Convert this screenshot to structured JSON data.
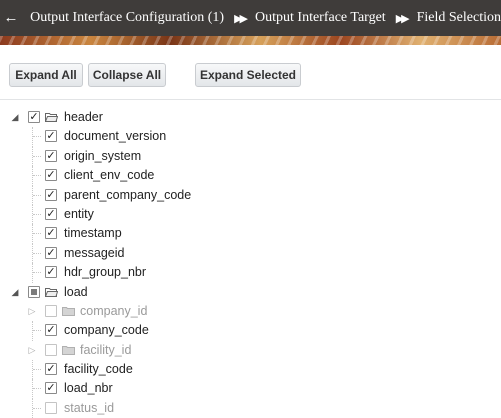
{
  "breadcrumb": {
    "back_icon": "back-arrow-icon",
    "items": [
      "Output Interface Configuration (1)",
      "Output Interface Target",
      "Field Selection"
    ],
    "separator": "▶▶"
  },
  "toolbar": {
    "expand_all": "Expand All",
    "collapse_all": "Collapse All",
    "expand_selected": "Expand Selected"
  },
  "tree": {
    "header": {
      "label": "header",
      "state": "checked",
      "children": [
        "document_version",
        "origin_system",
        "client_env_code",
        "parent_company_code",
        "entity",
        "timestamp",
        "messageid",
        "hdr_group_nbr"
      ]
    },
    "load": {
      "label": "load",
      "state": "partial",
      "children": [
        {
          "label": "company_id",
          "state": "unchecked",
          "folder": true
        },
        {
          "label": "company_code",
          "state": "checked"
        },
        {
          "label": "facility_id",
          "state": "unchecked",
          "folder": true
        },
        {
          "label": "facility_code",
          "state": "checked"
        },
        {
          "label": "load_nbr",
          "state": "checked"
        },
        {
          "label": "status_id",
          "state": "unchecked"
        }
      ]
    }
  },
  "colors": {
    "header_bg": "#3f3c3a",
    "button_border": "#c9ccd0",
    "disabled_text": "#9a9a9a"
  }
}
